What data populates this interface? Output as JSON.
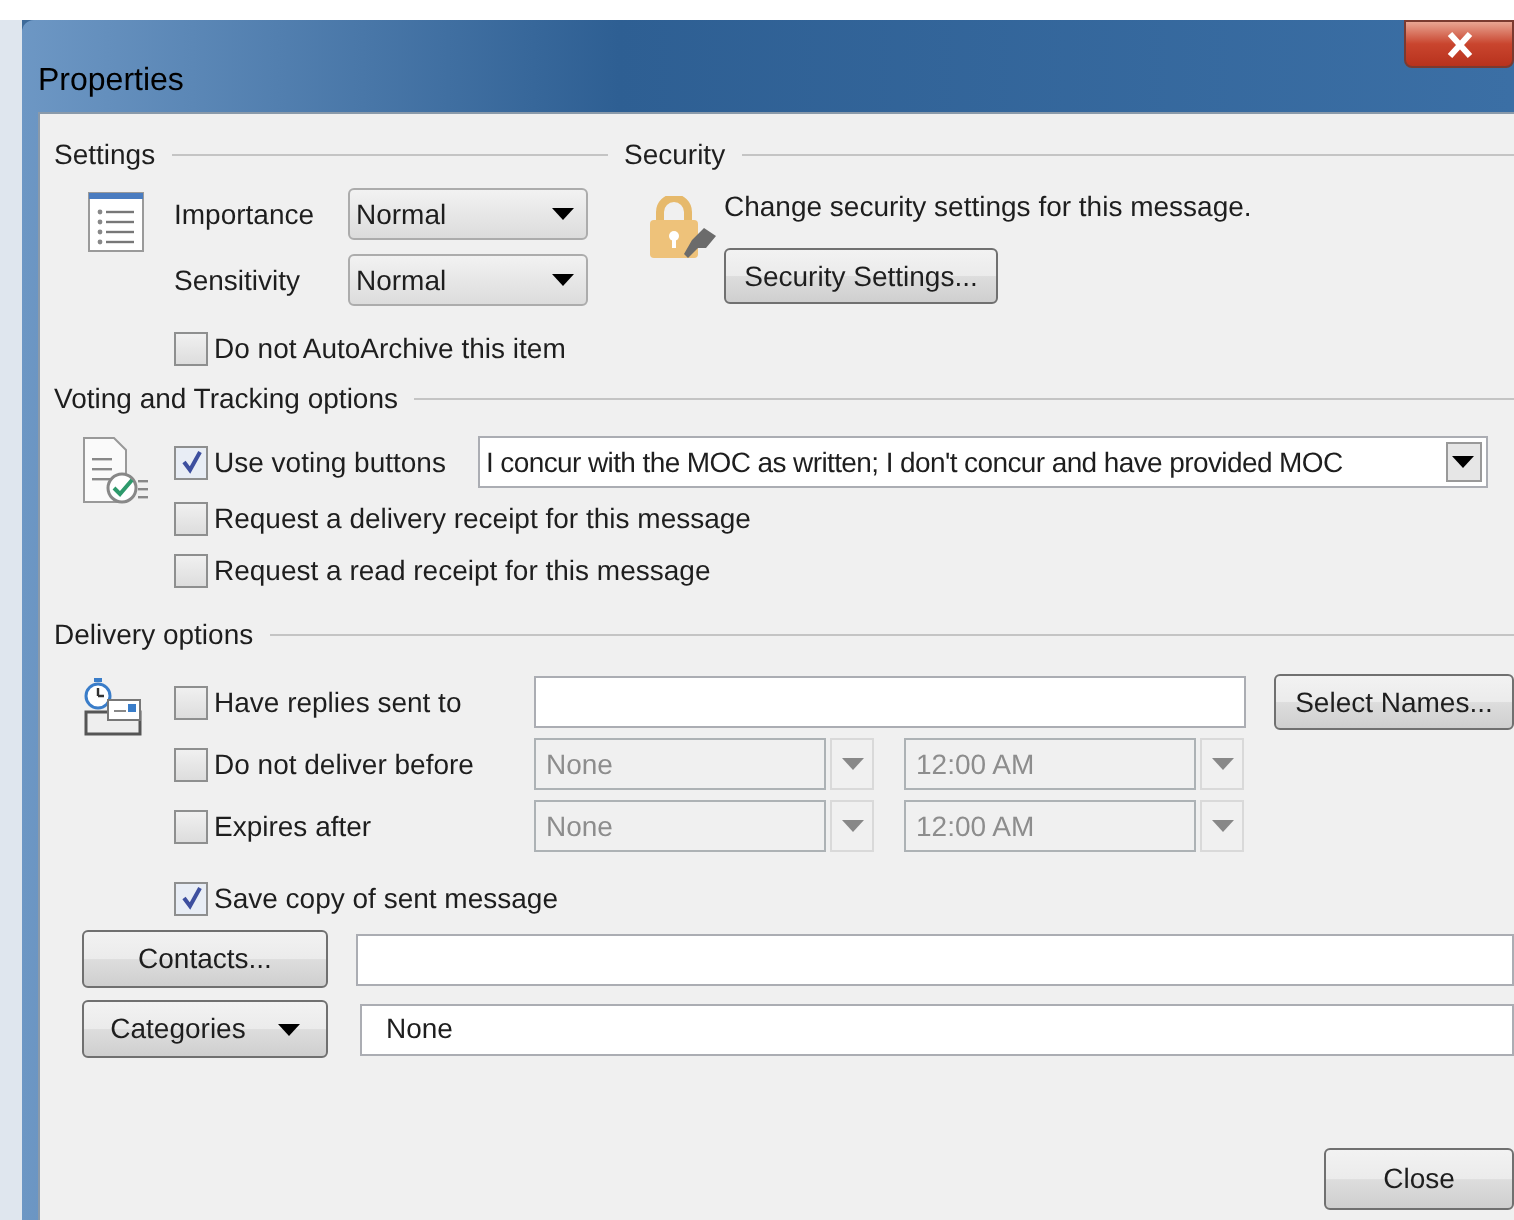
{
  "window": {
    "title": "Properties"
  },
  "settings": {
    "heading": "Settings",
    "importance": {
      "label": "Importance",
      "value": "Normal"
    },
    "sensitivity": {
      "label": "Sensitivity",
      "value": "Normal"
    },
    "autoarchive": {
      "label": "Do not AutoArchive this item",
      "checked": false
    }
  },
  "security": {
    "heading": "Security",
    "description": "Change security settings for this message.",
    "button": "Security Settings..."
  },
  "voting": {
    "heading": "Voting and Tracking options",
    "choices": "I concur with the MOC as written; I don't concur and have provided MOC",
    "options": [
      {
        "label": "Use voting buttons",
        "checked": true
      },
      {
        "label": "Request a delivery receipt for this message",
        "checked": false
      },
      {
        "label": "Request a read receipt for this message",
        "checked": false
      }
    ]
  },
  "delivery": {
    "heading": "Delivery options",
    "replies": {
      "label": "Have replies sent to",
      "checked": false,
      "button": "Select Names..."
    },
    "rows": [
      {
        "label": "Do not deliver before",
        "checked": false,
        "disabled": true,
        "date": "None",
        "time": "12:00 AM"
      },
      {
        "label": "Expires after",
        "checked": false,
        "disabled": true,
        "date": "None",
        "time": "12:00 AM"
      }
    ],
    "save_copy": {
      "label": "Save copy of sent message",
      "checked": true
    }
  },
  "contacts": {
    "button": "Contacts..."
  },
  "categories": {
    "button": "Categories",
    "value": "None"
  },
  "close_button": "Close"
}
